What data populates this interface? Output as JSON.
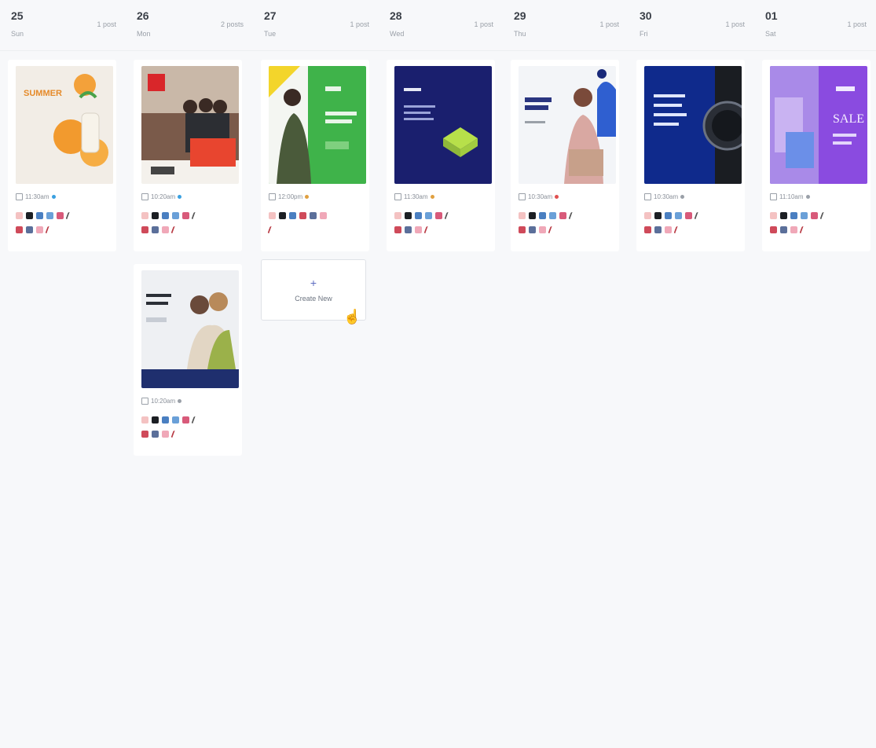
{
  "days": [
    {
      "num": "25",
      "name": "Sun",
      "count": "1 post"
    },
    {
      "num": "26",
      "name": "Mon",
      "count": "2 posts"
    },
    {
      "num": "27",
      "name": "Tue",
      "count": "1 post"
    },
    {
      "num": "28",
      "name": "Wed",
      "count": "1 post"
    },
    {
      "num": "29",
      "name": "Thu",
      "count": "1 post"
    },
    {
      "num": "30",
      "name": "Fri",
      "count": "1 post"
    },
    {
      "num": "01",
      "name": "Sat",
      "count": "1 post"
    }
  ],
  "posts": [
    {
      "time": "11:30am",
      "status_color": "#3aa0e0"
    },
    {
      "time": "10:20am",
      "status_color": "#3aa0e0"
    },
    {
      "time": "12:00pm",
      "status_color": "#3aa0e0"
    },
    {
      "time": "11:30am",
      "status_color": "#e0a040"
    },
    {
      "time": "10:30am",
      "status_color": "#3aa0e0"
    },
    {
      "time": "10:30am",
      "status_color": "#e05050"
    },
    {
      "time": "11:10am",
      "status_color": "#9aa0a8"
    },
    {
      "time": "10:20am",
      "status_color": "#9aa0a8"
    }
  ],
  "create": {
    "label": "Create New"
  },
  "networks": [
    "pinterest",
    "x",
    "linkedin",
    "facebook",
    "instagram",
    "tiktok",
    "youtube",
    "threads",
    "pinterest",
    "tiktok"
  ],
  "colors": {
    "accent": "#5c6bc0",
    "border": "#e6e8ec"
  }
}
